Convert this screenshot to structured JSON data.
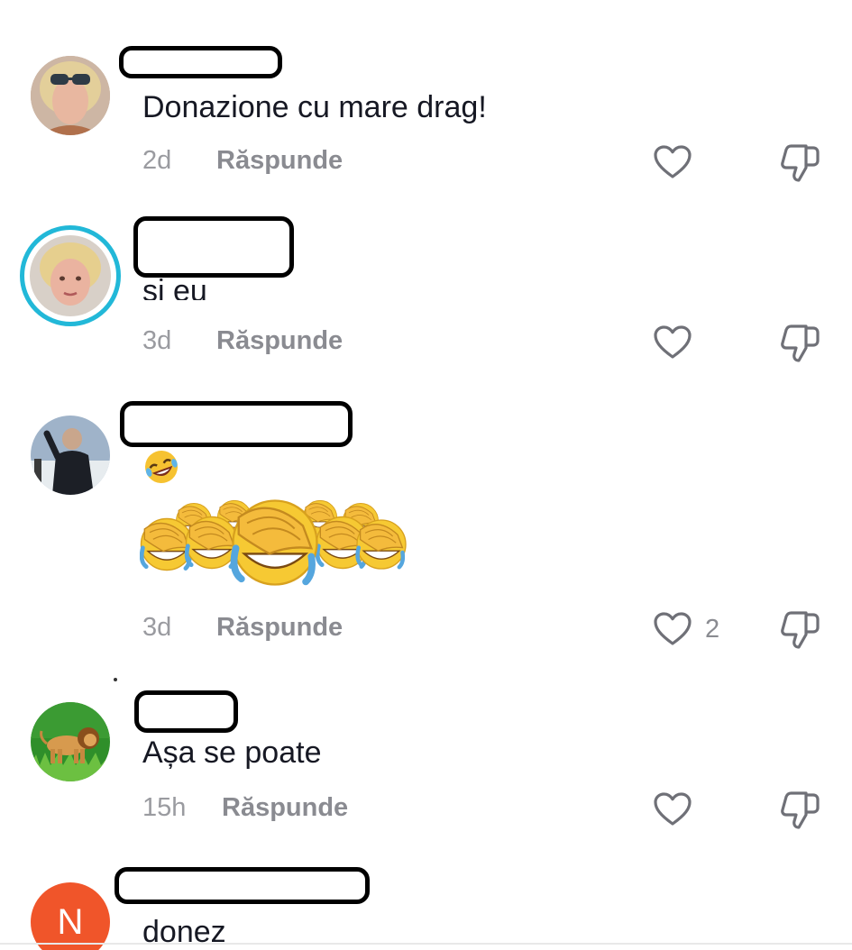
{
  "comments": [
    {
      "text": "Donazione cu mare drag!",
      "time": "2d",
      "reply_label": "Răspunde",
      "likes": "",
      "avatar_icon": "user-photo-avatar"
    },
    {
      "text": "și eu",
      "time": "3d",
      "reply_label": "Răspunde",
      "likes": "",
      "avatar_icon": "user-photo-avatar-story-ring",
      "story_ring_color": "#22b8d8"
    },
    {
      "text": "🤣",
      "time": "3d",
      "reply_label": "Răspunde",
      "likes": "2",
      "avatar_icon": "user-photo-avatar",
      "sticker": "facepalm-laughing-emoji-sticker"
    },
    {
      "text": "Așa se poate",
      "time": "15h",
      "reply_label": "Răspunde",
      "likes": "",
      "avatar_icon": "lion-avatar"
    },
    {
      "text": "donez",
      "avatar_letter": "N",
      "avatar_color": "#f0552a"
    }
  ],
  "icons": {
    "like": "heart-outline-icon",
    "dislike": "thumbs-down-outline-icon"
  },
  "colors": {
    "text": "#161823",
    "meta": "#8a8b91",
    "icon": "#6f7077"
  }
}
